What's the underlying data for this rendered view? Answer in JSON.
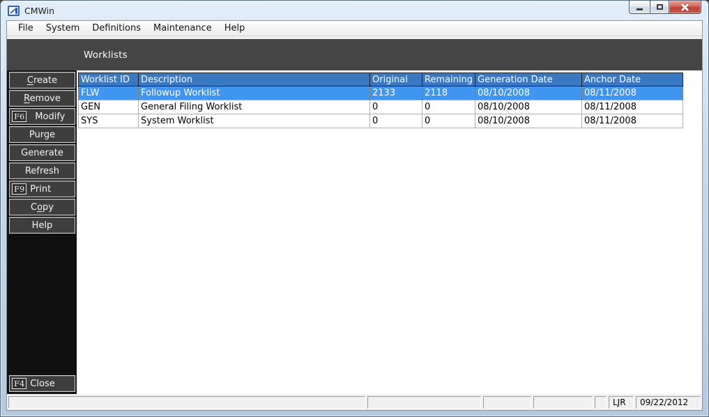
{
  "window": {
    "title": "CMWin"
  },
  "icons": {
    "app": "lst-logo-icon",
    "minimize": "minimize-icon",
    "maximize": "maximize-icon",
    "close": "close-icon"
  },
  "menu": {
    "items": [
      {
        "label": "File"
      },
      {
        "label": "System"
      },
      {
        "label": "Definitions"
      },
      {
        "label": "Maintenance"
      },
      {
        "label": "Help"
      }
    ]
  },
  "header": {
    "title": "Worklists"
  },
  "sidebar": {
    "buttons": [
      {
        "pre": "",
        "accel": "C",
        "post": "reate",
        "key": ""
      },
      {
        "pre": "",
        "accel": "R",
        "post": "emove",
        "key": ""
      },
      {
        "pre": "Modify",
        "accel": "",
        "post": "",
        "key": "F6"
      },
      {
        "pre": "Purge",
        "accel": "",
        "post": "",
        "key": ""
      },
      {
        "pre": "Generate",
        "accel": "",
        "post": "",
        "key": ""
      },
      {
        "pre": "Refresh",
        "accel": "",
        "post": "",
        "key": ""
      },
      {
        "pre": "Print",
        "accel": "",
        "post": "",
        "key": "F9"
      },
      {
        "pre": "C",
        "accel": "o",
        "post": "py",
        "key": ""
      },
      {
        "pre": "Help",
        "accel": "",
        "post": "",
        "key": ""
      }
    ],
    "close_button": {
      "key": "F4",
      "pre": "Close"
    }
  },
  "table": {
    "columns": [
      "Worklist ID",
      "Description",
      "Original",
      "Remaining",
      "Generation Date",
      "Anchor Date"
    ],
    "selected_row_index": 0,
    "rows": [
      {
        "cells": [
          "FLW",
          "Followup Worklist",
          "2133",
          "2118",
          "08/10/2008",
          "08/11/2008"
        ],
        "selected": true
      },
      {
        "cells": [
          "GEN",
          "General Filing Worklist",
          "0",
          "0",
          "08/10/2008",
          "08/11/2008"
        ],
        "selected": false
      },
      {
        "cells": [
          "SYS",
          "System Worklist",
          "0",
          "0",
          "08/10/2008",
          "08/11/2008"
        ],
        "selected": false
      }
    ]
  },
  "status_bar": {
    "user": "LJR",
    "date": "09/22/2012"
  },
  "colors": {
    "table_header_blue": "#3a79c1",
    "selected_row_blue": "#3f95ef",
    "dark_panel": "#454545",
    "sidebar_bg": "#101010",
    "button_face": "#3e3e3e",
    "close_button_red": "#bd4134"
  }
}
